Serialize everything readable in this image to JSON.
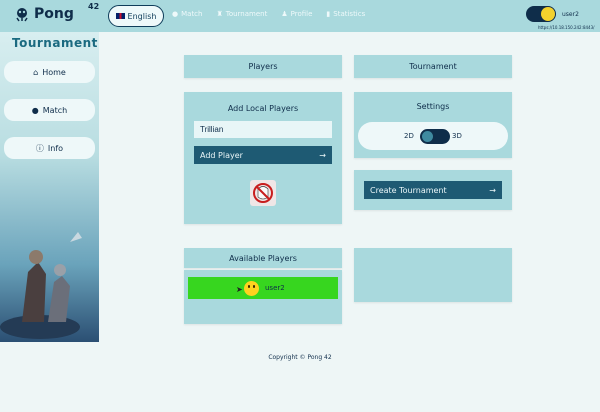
{
  "header": {
    "logo_text": "Pong",
    "logo_sup": "42",
    "language": "English",
    "nav": [
      {
        "label": "Match",
        "icon": "match-icon"
      },
      {
        "label": "Tournament",
        "icon": "trophy-icon"
      },
      {
        "label": "Profile",
        "icon": "profile-icon"
      },
      {
        "label": "Statistics",
        "icon": "statistics-icon"
      }
    ],
    "username": "user2",
    "url": "https://10.18.150.242:8443/"
  },
  "sidebar": {
    "title": "Tournament",
    "items": [
      {
        "label": "Home",
        "icon": "home-icon"
      },
      {
        "label": "Match",
        "icon": "match-icon"
      },
      {
        "label": "Info",
        "icon": "info-icon"
      }
    ]
  },
  "main": {
    "players_header": "Players",
    "tournament_header": "Tournament",
    "add_local": {
      "title": "Add Local Players",
      "input_value": "Trillian",
      "button_label": "Add Player"
    },
    "settings": {
      "title": "Settings",
      "option_left": "2D",
      "option_right": "3D"
    },
    "create_button": "Create Tournament",
    "available": {
      "title": "Available Players",
      "players": [
        {
          "name": "user2"
        }
      ]
    }
  },
  "footer": "Copyright © Pong 42",
  "colors": {
    "topbar": "#a9d9dd",
    "button_dark": "#1e5a73",
    "available_green": "#37d61f"
  }
}
